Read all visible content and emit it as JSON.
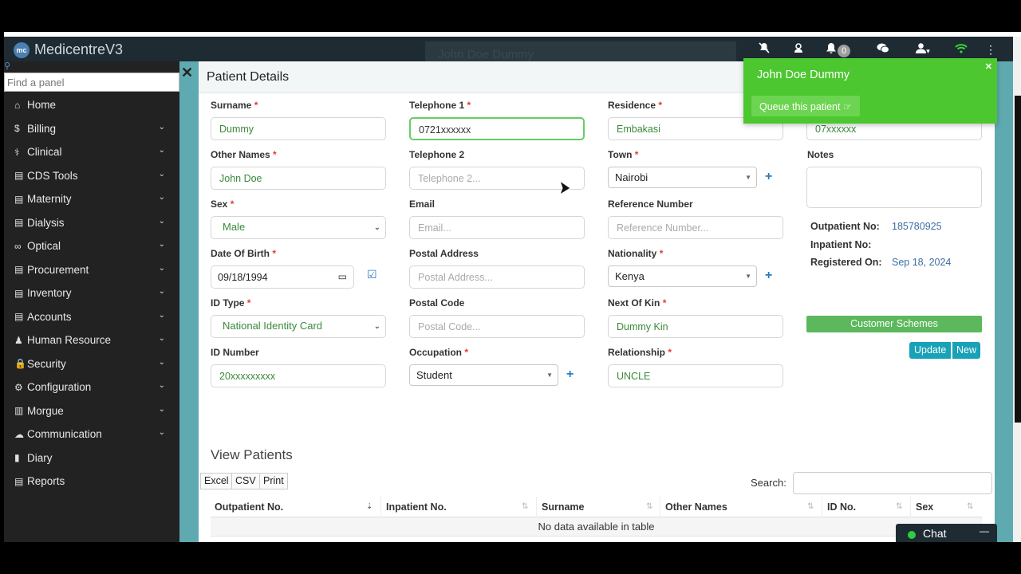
{
  "app": {
    "brand": "MedicentreV3",
    "logo_text": "mc",
    "ghost_title": "John Doe Dummy"
  },
  "topbar": {
    "notification_count": "0",
    "icons": [
      "mute-icon",
      "support-icon",
      "bell-icon",
      "chat-bubbles-icon",
      "user-icon",
      "wifi-icon",
      "kebab-menu-icon"
    ],
    "wifi_color": "#39d339"
  },
  "sidebar": {
    "search_placeholder": "Find a panel",
    "items": [
      {
        "label": "Home",
        "icon": "⌂",
        "has_submenu": false
      },
      {
        "label": "Billing",
        "icon": "$",
        "has_submenu": true
      },
      {
        "label": "Clinical",
        "icon": "⚕",
        "has_submenu": true
      },
      {
        "label": "CDS Tools",
        "icon": "▤",
        "has_submenu": true
      },
      {
        "label": "Maternity",
        "icon": "▤",
        "has_submenu": true
      },
      {
        "label": "Dialysis",
        "icon": "▤",
        "has_submenu": true
      },
      {
        "label": "Optical",
        "icon": "∞",
        "has_submenu": true
      },
      {
        "label": "Procurement",
        "icon": "▤",
        "has_submenu": true
      },
      {
        "label": "Inventory",
        "icon": "▤",
        "has_submenu": true
      },
      {
        "label": "Accounts",
        "icon": "▤",
        "has_submenu": true
      },
      {
        "label": "Human Resource",
        "icon": "♟",
        "has_submenu": true
      },
      {
        "label": "Security",
        "icon": "🔒",
        "has_submenu": true
      },
      {
        "label": "Configuration",
        "icon": "⚙",
        "has_submenu": true
      },
      {
        "label": "Morgue",
        "icon": "▥",
        "has_submenu": true
      },
      {
        "label": "Communication",
        "icon": "☁",
        "has_submenu": true
      },
      {
        "label": "Diary",
        "icon": "▮",
        "has_submenu": false
      },
      {
        "label": "Reports",
        "icon": "▤",
        "has_submenu": false
      }
    ]
  },
  "modal": {
    "title": "Patient Details"
  },
  "form": {
    "surname": {
      "label": "Surname",
      "value": "Dummy"
    },
    "other_names": {
      "label": "Other Names",
      "value": "John Doe"
    },
    "sex": {
      "label": "Sex",
      "value": "Male"
    },
    "dob": {
      "label": "Date Of Birth",
      "value": "09/18/1994"
    },
    "id_type": {
      "label": "ID Type",
      "value": "National Identity Card"
    },
    "id_number": {
      "label": "ID Number",
      "value": "20xxxxxxxxx"
    },
    "telephone1": {
      "label": "Telephone 1",
      "value": "0721xxxxxx"
    },
    "telephone2": {
      "label": "Telephone 2",
      "placeholder": "Telephone 2..."
    },
    "email": {
      "label": "Email",
      "placeholder": "Email..."
    },
    "postal_address": {
      "label": "Postal Address",
      "placeholder": "Postal Address..."
    },
    "postal_code": {
      "label": "Postal Code",
      "placeholder": "Postal Code..."
    },
    "occupation": {
      "label": "Occupation",
      "value": "Student"
    },
    "residence": {
      "label": "Residence",
      "value": "Embakasi"
    },
    "town": {
      "label": "Town",
      "value": "Nairobi"
    },
    "reference_number": {
      "label": "Reference Number",
      "placeholder": "Reference Number..."
    },
    "nationality": {
      "label": "Nationality",
      "value": "Kenya"
    },
    "next_of_kin": {
      "label": "Next Of Kin",
      "value": "Dummy Kin"
    },
    "relationship": {
      "label": "Relationship",
      "value": "UNCLE"
    },
    "kin_phone": {
      "value": "07xxxxxx"
    },
    "notes": {
      "label": "Notes"
    }
  },
  "patient_info": {
    "outpatient_label": "Outpatient No:",
    "outpatient_value": "185780925",
    "inpatient_label": "Inpatient No:",
    "inpatient_value": "",
    "registered_label": "Registered On:",
    "registered_value": "Sep 18, 2024"
  },
  "buttons": {
    "customer_schemes": "Customer Schemes",
    "update": "Update",
    "new": "New"
  },
  "patients_table": {
    "title": "View Patients",
    "export_buttons": [
      "Excel",
      "CSV",
      "Print"
    ],
    "search_label": "Search:",
    "columns": [
      "Outpatient No.",
      "Inpatient No.",
      "Surname",
      "Other Names",
      "ID No.",
      "Sex"
    ],
    "empty_message": "No data available in table"
  },
  "notification": {
    "title": "John Doe Dummy",
    "action": "Queue this patient ☞",
    "color": "#4cc730"
  },
  "chat": {
    "label": "Chat",
    "minimize": "—"
  }
}
